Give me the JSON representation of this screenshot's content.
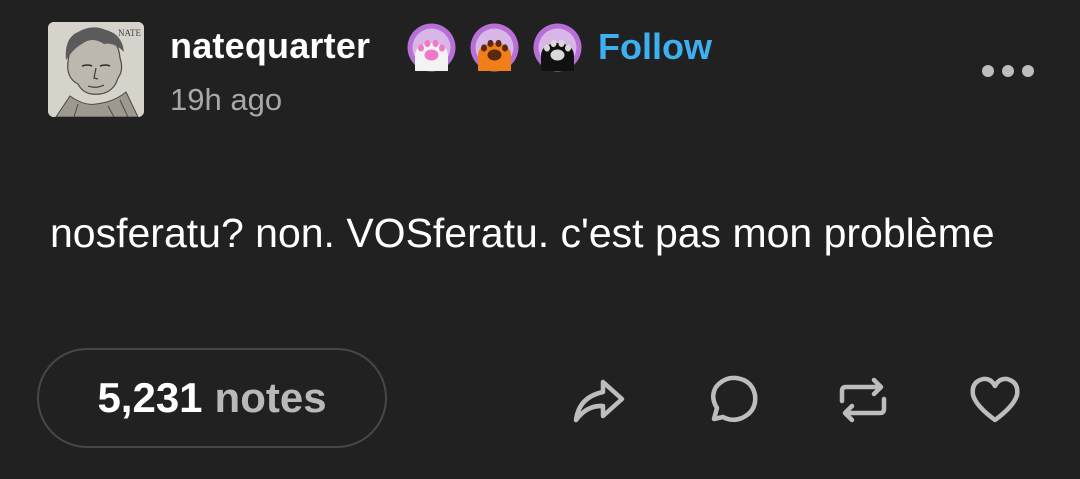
{
  "post": {
    "username": "natequarter",
    "follow_label": "Follow",
    "timestamp": "19h ago",
    "body": "nosferatu? non. VOSferatu. c'est pas mon problème",
    "avatar_text": "NATE",
    "notes": {
      "count": "5,231",
      "label": "notes"
    }
  },
  "badges": [
    {
      "icon": "paw-pink-icon",
      "ring": "#b86fd6",
      "fill": "#f3f3f3",
      "pads": "#f07ac8"
    },
    {
      "icon": "paw-orange-icon",
      "ring": "#b86fd6",
      "fill": "#f07f1a",
      "pads": "#5a2a0e"
    },
    {
      "icon": "paw-black-icon",
      "ring": "#b86fd6",
      "fill": "#111111",
      "pads": "#d9d9d9"
    }
  ],
  "actions": [
    "share-icon",
    "reply-icon",
    "reblog-icon",
    "like-icon"
  ],
  "colors": {
    "background": "#212121",
    "follow": "#3db1f0",
    "muted": "#a8a8a8"
  }
}
